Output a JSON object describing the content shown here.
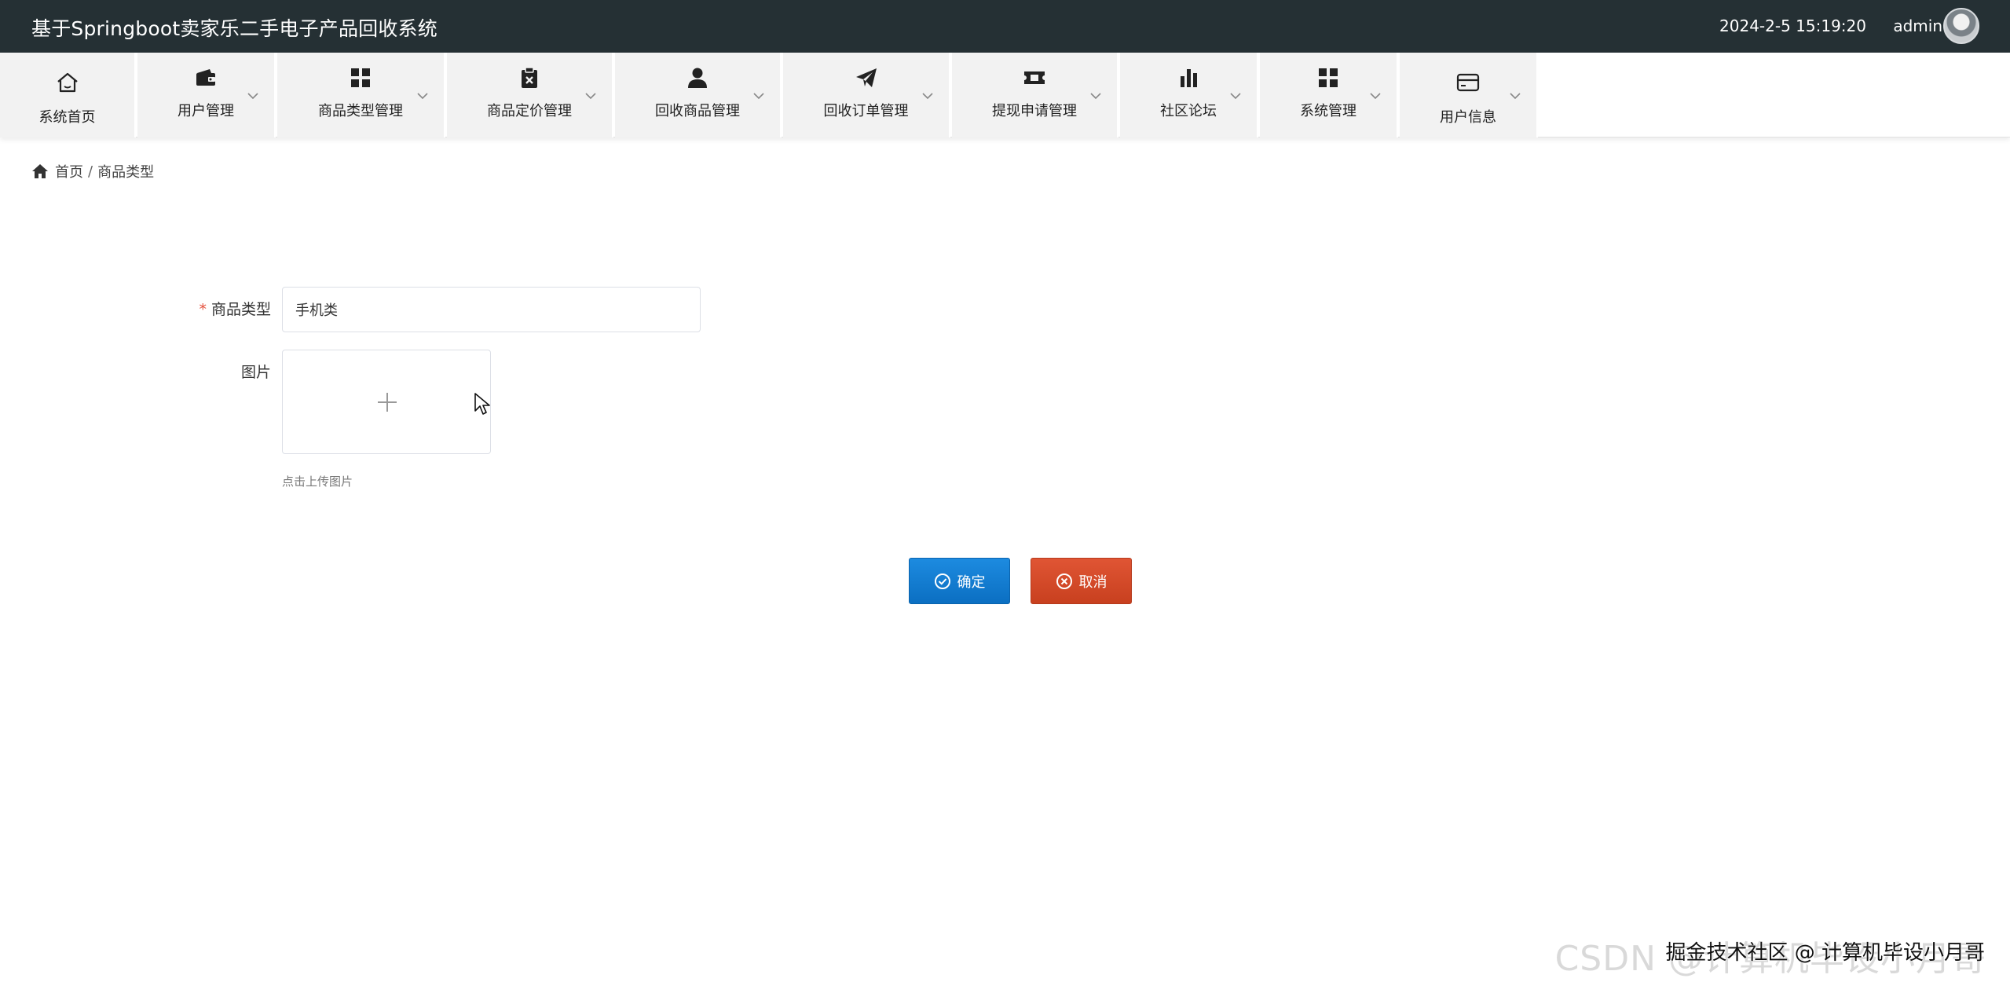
{
  "header": {
    "title": "基于Springboot卖家乐二手电子产品回收系统",
    "datetime": "2024-2-5 15:19:20",
    "username": "admin"
  },
  "nav": {
    "items": [
      {
        "label": "系统首页",
        "icon": "home-icon"
      },
      {
        "label": "用户管理",
        "icon": "wallet-icon"
      },
      {
        "label": "商品类型管理",
        "icon": "grid-icon"
      },
      {
        "label": "商品定价管理",
        "icon": "clipboard-x-icon"
      },
      {
        "label": "回收商品管理",
        "icon": "user-icon"
      },
      {
        "label": "回收订单管理",
        "icon": "paper-plane-icon"
      },
      {
        "label": "提现申请管理",
        "icon": "ticket-icon"
      },
      {
        "label": "社区论坛",
        "icon": "bar-chart-icon"
      },
      {
        "label": "系统管理",
        "icon": "grid-icon"
      },
      {
        "label": "用户信息",
        "icon": "card-icon"
      }
    ]
  },
  "breadcrumb": {
    "home": "首页",
    "separator": "/",
    "current": "商品类型"
  },
  "form": {
    "type_label": "商品类型",
    "required_mark": "*",
    "type_value": "手机类",
    "image_label": "图片",
    "upload_hint": "点击上传图片"
  },
  "actions": {
    "confirm_label": "确定",
    "cancel_label": "取消"
  },
  "watermark": {
    "faint_text": "CSDN @计算机毕设小月哥",
    "overlay_text": "掘金技术社区 @ 计算机毕设小月哥"
  },
  "colors": {
    "header_bg": "#253034",
    "nav_item_bg": "#f2f2f2",
    "confirm_bg": "#0b6fc2",
    "cancel_bg": "#c8401f",
    "required": "#e44f3b"
  }
}
